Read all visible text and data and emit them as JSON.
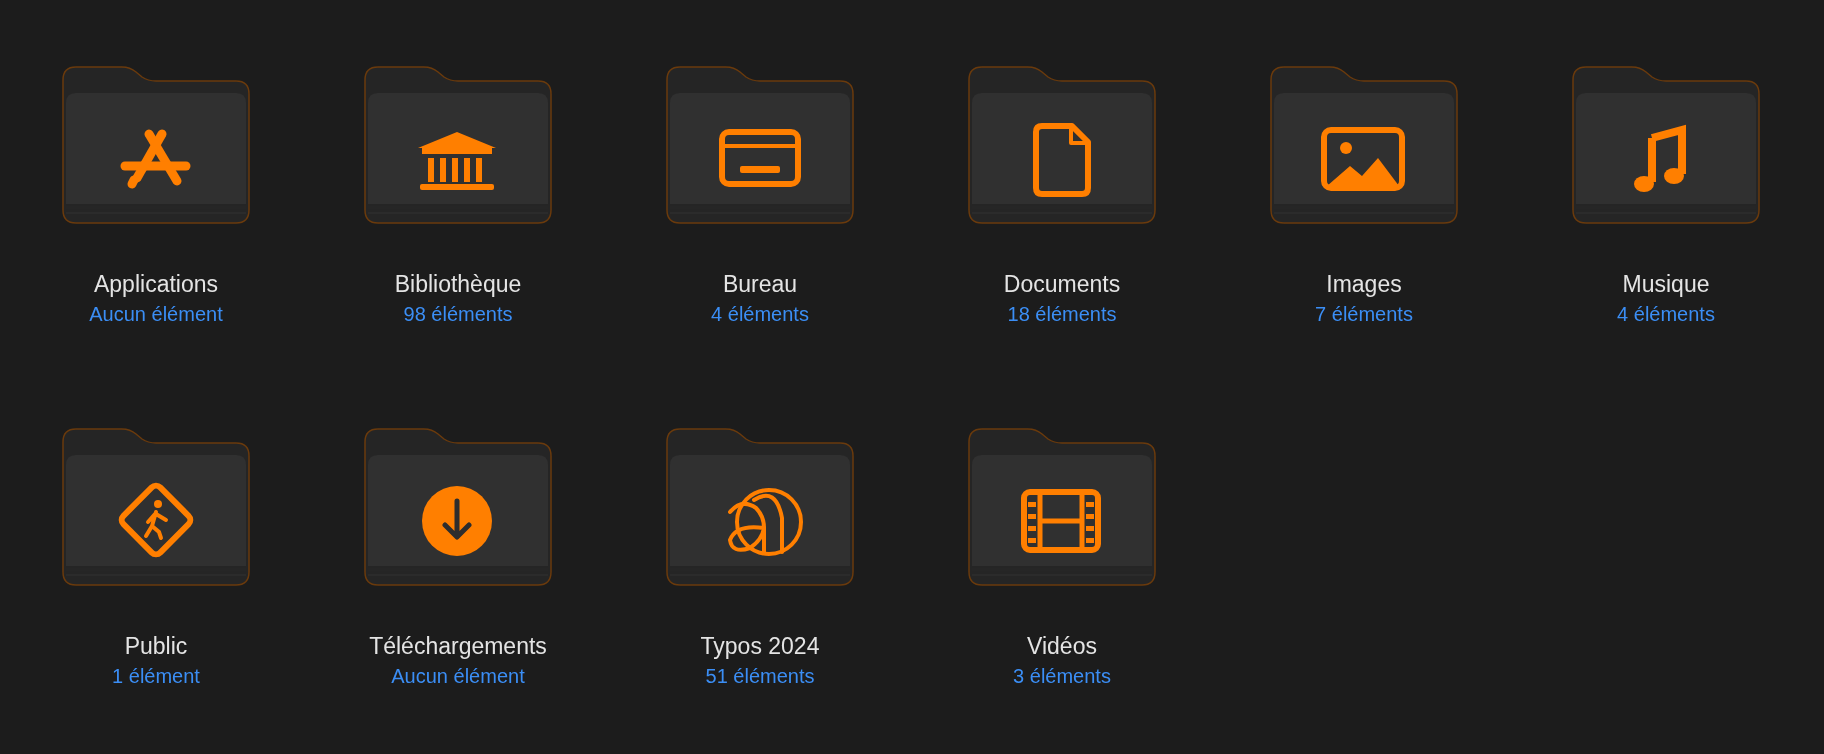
{
  "folders": [
    {
      "name": "Applications",
      "count": "Aucun élément",
      "kind": "apps"
    },
    {
      "name": "Bibliothèque",
      "count": "98 éléments",
      "kind": "library"
    },
    {
      "name": "Bureau",
      "count": "4 éléments",
      "kind": "desktop"
    },
    {
      "name": "Documents",
      "count": "18 éléments",
      "kind": "document"
    },
    {
      "name": "Images",
      "count": "7 éléments",
      "kind": "pictures"
    },
    {
      "name": "Musique",
      "count": "4 éléments",
      "kind": "music"
    },
    {
      "name": "Public",
      "count": "1 élément",
      "kind": "public"
    },
    {
      "name": "Téléchargements",
      "count": "Aucun élément",
      "kind": "downloads"
    },
    {
      "name": "Typos 2024",
      "count": "51 éléments",
      "kind": "fonts"
    },
    {
      "name": "Vidéos",
      "count": "3 éléments",
      "kind": "movies"
    }
  ]
}
